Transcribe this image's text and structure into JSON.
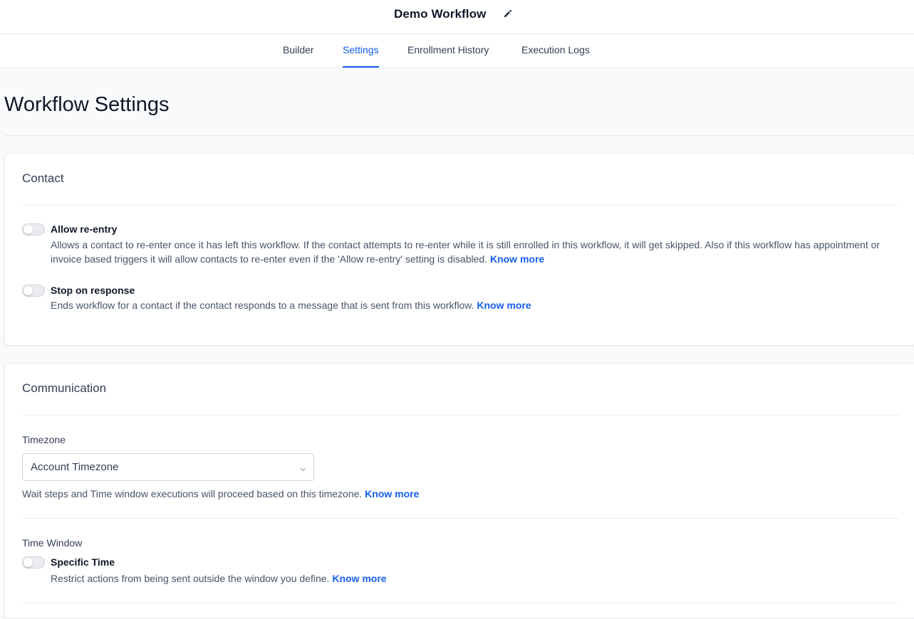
{
  "header": {
    "workflow_title": "Demo Workflow",
    "edit_icon": "pencil-icon"
  },
  "tabs": [
    {
      "label": "Builder",
      "active": false
    },
    {
      "label": "Settings",
      "active": true
    },
    {
      "label": "Enrollment History",
      "active": false
    },
    {
      "label": "Execution Logs",
      "active": false
    }
  ],
  "page": {
    "title": "Workflow Settings"
  },
  "contact": {
    "title": "Contact",
    "allow_reentry": {
      "label": "Allow re-entry",
      "enabled": false,
      "description": "Allows a contact to re-enter once it has left this workflow. If the contact attempts to re-enter while it is still enrolled in this workflow, it will get skipped. Also if this workflow has appointment or invoice based triggers it will allow contacts to re-enter even if the 'Allow re-entry' setting is disabled.",
      "link": "Know more"
    },
    "stop_on_response": {
      "label": "Stop on response",
      "enabled": false,
      "description": "Ends workflow for a contact if the contact responds to a message that is sent from this workflow.",
      "link": "Know more"
    }
  },
  "communication": {
    "title": "Communication",
    "timezone": {
      "label": "Timezone",
      "selected": "Account Timezone",
      "help": "Wait steps and Time window executions will proceed based on this timezone.",
      "link": "Know more"
    },
    "time_window": {
      "label": "Time Window",
      "toggle_label": "Specific Time",
      "enabled": false,
      "description": "Restrict actions from being sent outside the window you define.",
      "link": "Know more"
    }
  },
  "colors": {
    "accent": "#155eef",
    "text": "#101828",
    "muted": "#475467",
    "border": "#e5e7eb"
  }
}
